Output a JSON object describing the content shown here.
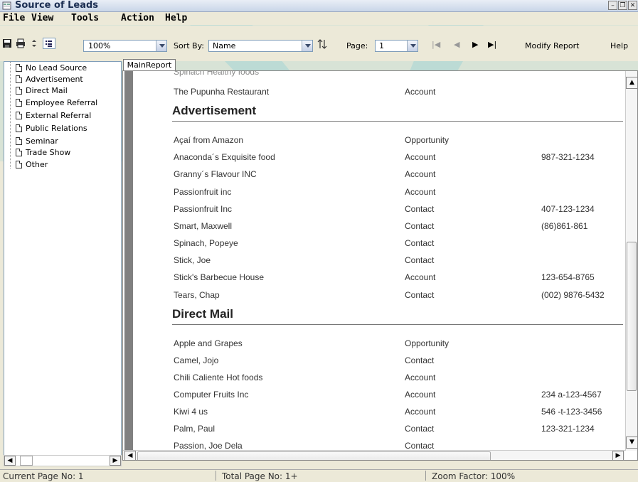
{
  "window": {
    "title": "Source of Leads"
  },
  "menu": [
    "File",
    "View",
    "Tools",
    "Action",
    "Help"
  ],
  "toolbar": {
    "zoom": "100%",
    "sort_label": "Sort By:",
    "sort_value": "Name",
    "page_label": "Page:",
    "page_value": "1",
    "modify_report": "Modify Report",
    "help": "Help"
  },
  "sidebar": {
    "items": [
      "No Lead Source",
      "Advertisement",
      "Direct Mail",
      "Employee Referral",
      "External Referral",
      "Public Relations",
      "Seminar",
      "Trade Show",
      "Other"
    ]
  },
  "tab": "MainReport",
  "report": {
    "top_rows": [
      {
        "name": "The Pupunha Restaurant",
        "type": "Account",
        "phone": ""
      }
    ],
    "sections": [
      {
        "title": "Advertisement",
        "rows": [
          {
            "name": "Açaí from Amazon",
            "type": "Opportunity",
            "phone": ""
          },
          {
            "name": "Anaconda´s Exquisite food",
            "type": "Account",
            "phone": "987-321-1234"
          },
          {
            "name": "Granny´s  Flavour INC",
            "type": "Account",
            "phone": ""
          },
          {
            "name": "Passionfruit inc",
            "type": "Account",
            "phone": ""
          },
          {
            "name": "Passionfruit Inc",
            "type": "Contact",
            "phone": "407-123-1234"
          },
          {
            "name": "Smart, Maxwell",
            "type": "Contact",
            "phone": "(86)861-861"
          },
          {
            "name": "Spinach, Popeye",
            "type": "Contact",
            "phone": ""
          },
          {
            "name": "Stick, Joe",
            "type": "Contact",
            "phone": ""
          },
          {
            "name": "Stick's Barbecue House",
            "type": "Account",
            "phone": "123-654-8765"
          },
          {
            "name": "Tears, Chap",
            "type": "Contact",
            "phone": "(002) 9876-5432"
          }
        ]
      },
      {
        "title": "Direct Mail",
        "rows": [
          {
            "name": "Apple and Grapes",
            "type": "Opportunity",
            "phone": ""
          },
          {
            "name": "Camel, Jojo",
            "type": "Contact",
            "phone": ""
          },
          {
            "name": "Chili Caliente Hot foods",
            "type": "Account",
            "phone": ""
          },
          {
            "name": "Computer Fruits Inc",
            "type": "Account",
            "phone": "234 a-123-4567"
          },
          {
            "name": "Kiwi 4 us",
            "type": "Account",
            "phone": "546 -t-123-3456"
          },
          {
            "name": "Palm, Paul",
            "type": "Contact",
            "phone": "123-321-1234"
          },
          {
            "name": "Passion, Joe Dela",
            "type": "Contact",
            "phone": ""
          }
        ]
      }
    ]
  },
  "status": {
    "current_page": "Current Page No: 1",
    "total_page": "Total Page No: 1+",
    "zoom": "Zoom Factor: 100%"
  }
}
